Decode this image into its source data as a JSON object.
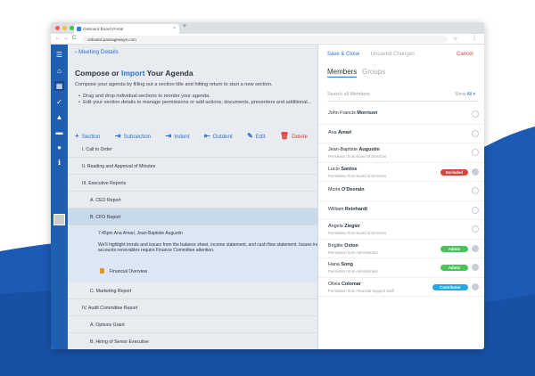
{
  "colors": {
    "brand_blue": "#1f5fb0",
    "link_blue": "#2f73c9",
    "danger_red": "#d9423b",
    "success_green": "#4cc35a",
    "contributor_blue": "#28a6e2",
    "bg_wave": "#1d5ab5"
  },
  "browser": {
    "tab_title": "OnBoard Board Portal",
    "tab_close": "×",
    "tab_new": "+",
    "url": "onboard.passageways.com",
    "nav_back": "←",
    "nav_forward": "→",
    "nav_reload": "C",
    "star_icon": "☆",
    "menu_icon": "⋮"
  },
  "sidebar": {
    "icons": [
      "menu-icon",
      "home-icon",
      "calendar-icon",
      "check-icon",
      "warning-icon",
      "folder-icon",
      "user-icon",
      "info-icon"
    ],
    "glyphs": [
      "☰",
      "⌂",
      "▦",
      "✓",
      "▲",
      "▬",
      "●",
      "ℹ"
    ]
  },
  "main": {
    "back_label": "Meeting Details",
    "title_part1": "Compose or ",
    "title_link": "Import",
    "title_part2": " Your Agenda",
    "instruction": "Compose your agenda by filling out a section title and hitting return to start a new section.",
    "bullets": [
      "Drag and drop individual sections to reorder your agenda.",
      "Edit your section details to manage permissions or add actions, documents, presenters and additional..."
    ],
    "toolbar": [
      {
        "icon": "+",
        "label": "Section"
      },
      {
        "icon": "⇥",
        "label": "Subsection"
      },
      {
        "icon": "⇥",
        "label": "Indent"
      },
      {
        "icon": "⇤",
        "label": "Outdent"
      },
      {
        "icon": "✎",
        "label": "Edit"
      },
      {
        "icon": "🗑",
        "label": "Delete"
      }
    ],
    "agenda": [
      {
        "label": "I.   Call to Order"
      },
      {
        "label": "II.   Reading and Approval of Minutes"
      },
      {
        "label": "III.   Executive Reports"
      },
      {
        "label": "A.   CEO Report"
      },
      {
        "label": "B.   CFO Report"
      },
      {
        "label": "C.   Marketing Report"
      },
      {
        "label": "IV.   Audit Committee Report"
      },
      {
        "label": "A.   Options Grant"
      },
      {
        "label": "B.   Hiring of Senior Executive"
      }
    ],
    "detail": {
      "time": "7:45pm    Ana Amari, Jean-Baptiste Augustin",
      "para1": "We'll highlight trends and issues from the balance sheet, income statement, and cash flow statement. Issues includ...",
      "para2": "accounts receivables require Finance Committee attention.",
      "doc": "Financial Overview"
    }
  },
  "panel": {
    "save_close": "Save & Close",
    "unsaved": "· Unsaved Changes",
    "cancel": "Cancel",
    "tab_members": "Members",
    "tab_groups": "Groups",
    "search_placeholder": "Search all Members",
    "show_label": "Show",
    "show_value": "All",
    "show_caret": "▾",
    "members": [
      {
        "first": "John Francis ",
        "last": "Morrison",
        "perm": "",
        "badge": "",
        "checked": false
      },
      {
        "first": "Ana ",
        "last": "Amari",
        "perm": "",
        "badge": "",
        "checked": false
      },
      {
        "first": "Jean-Baptiste ",
        "last": "Augustin",
        "perm": "Permission from Board of Directors",
        "badge": "",
        "checked": false
      },
      {
        "first": "Lucio ",
        "last": "Santos",
        "perm": "Permission from Board of Directors",
        "badge": "Excluded",
        "checked": true
      },
      {
        "first": "Moira ",
        "last": "O'Deorain",
        "perm": "",
        "badge": "",
        "checked": false
      },
      {
        "first": "William ",
        "last": "Reinhardt",
        "perm": "",
        "badge": "",
        "checked": false
      },
      {
        "first": "Angela ",
        "last": "Ziegler",
        "perm": "Permission from Board of Directors",
        "badge": "",
        "checked": false
      },
      {
        "first": "Brigitte ",
        "last": "Oxton",
        "perm": "Permission from Administrator",
        "badge": "Admin",
        "checked": true
      },
      {
        "first": "Hana ",
        "last": "Song",
        "perm": "Permission from Administrator",
        "badge": "Admin",
        "checked": true
      },
      {
        "first": "Olivia ",
        "last": "Colomar",
        "perm": "Permission from Financial Support Staff",
        "badge": "Contributor",
        "checked": true
      }
    ]
  }
}
